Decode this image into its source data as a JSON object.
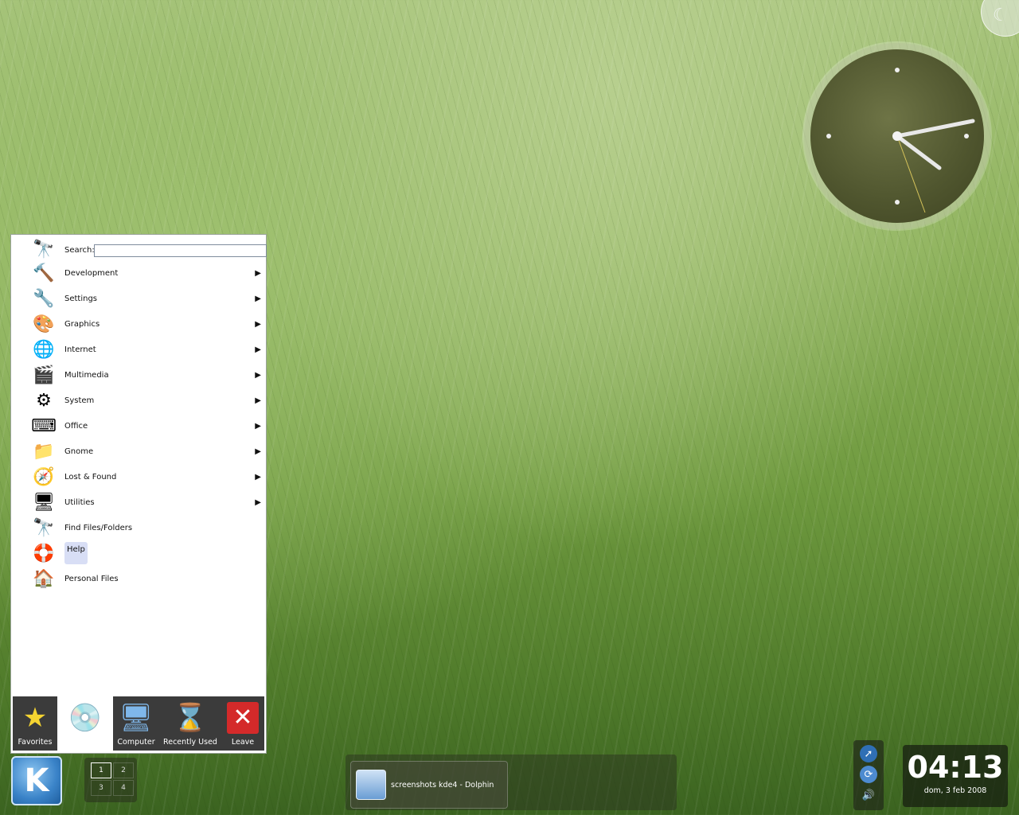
{
  "menu": {
    "search_label": "Search:",
    "search_value": "",
    "items": [
      {
        "label": "Development",
        "submenu": true
      },
      {
        "label": "Settings",
        "submenu": true
      },
      {
        "label": "Graphics",
        "submenu": true
      },
      {
        "label": "Internet",
        "submenu": true
      },
      {
        "label": "Multimedia",
        "submenu": true
      },
      {
        "label": "System",
        "submenu": true
      },
      {
        "label": "Office",
        "submenu": true
      },
      {
        "label": "Gnome",
        "submenu": true
      },
      {
        "label": "Lost & Found",
        "submenu": true
      },
      {
        "label": "Utilities",
        "submenu": true
      },
      {
        "label": "Find Files/Folders",
        "submenu": false
      },
      {
        "label": "Help",
        "submenu": false
      },
      {
        "label": "Personal Files",
        "submenu": false
      }
    ],
    "submenu_arrow": "▶",
    "tabs": [
      {
        "label": "Favorites",
        "icon": "star-icon"
      },
      {
        "label": "",
        "icon": "applications-icon"
      },
      {
        "label": "Computer",
        "icon": "computer-icon"
      },
      {
        "label": "Recently Used",
        "icon": "hourglass-icon"
      },
      {
        "label": "Leave",
        "icon": "close-icon"
      }
    ]
  },
  "pager": {
    "desktops": [
      "1",
      "2",
      "3",
      "4"
    ],
    "current": "1"
  },
  "taskbar": {
    "tasks": [
      {
        "label": "screenshots kde4 - Dolphin"
      }
    ]
  },
  "clock": {
    "time": "04:13",
    "date": "dom, 3 feb 2008"
  },
  "kmenu_button": {
    "label": "K"
  },
  "colors": {
    "menu_highlight": "#d8def5",
    "panel": "#3b3b3b"
  }
}
